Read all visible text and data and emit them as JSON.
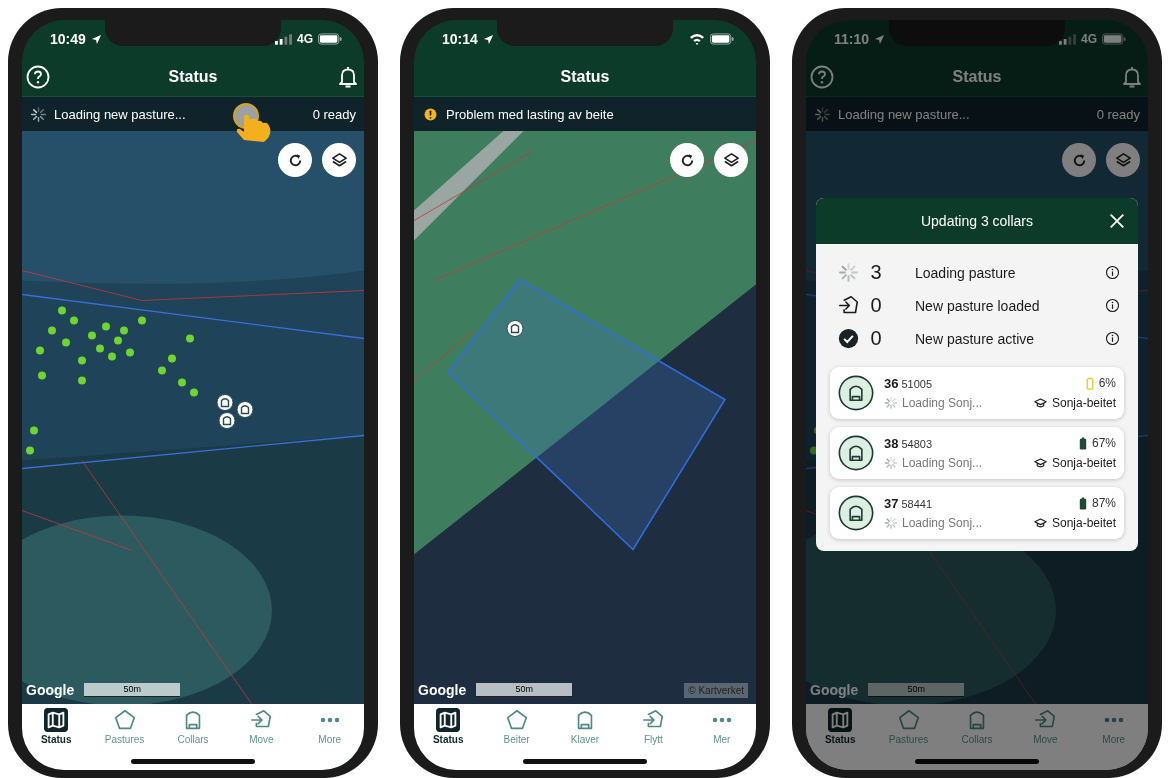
{
  "phones": [
    {
      "status_bar": {
        "time": "10:49",
        "connection": {
          "kind": "cellular",
          "label": "4G"
        }
      },
      "header": {
        "title": "Status",
        "help": true,
        "bell": true
      },
      "notice": {
        "kind": "loading",
        "text": "Loading new pasture...",
        "ready": "0 ready"
      },
      "tap_hint": true,
      "dimmed": false,
      "map": {
        "kind": "forest",
        "attribution": "Google",
        "scale": "50m"
      },
      "tabs": [
        {
          "kind": "map",
          "label": "Status",
          "selected": true
        },
        {
          "kind": "pasture",
          "label": "Pastures",
          "selected": false
        },
        {
          "kind": "collar",
          "label": "Collars",
          "selected": false
        },
        {
          "kind": "move",
          "label": "Move",
          "selected": false
        },
        {
          "kind": "more",
          "label": "More",
          "selected": false
        }
      ]
    },
    {
      "status_bar": {
        "time": "10:14",
        "connection": {
          "kind": "wifi"
        }
      },
      "header": {
        "title": "Status",
        "help": false,
        "bell": false
      },
      "notice": {
        "kind": "warning",
        "text": "Problem med lasting av beite"
      },
      "tap_hint": false,
      "dimmed": false,
      "map": {
        "kind": "field",
        "attribution": "Google",
        "scale": "50m",
        "credit": "© Kartverket"
      },
      "tabs": [
        {
          "kind": "map",
          "label": "Status",
          "selected": true
        },
        {
          "kind": "pasture",
          "label": "Beiter",
          "selected": false
        },
        {
          "kind": "collar",
          "label": "Klaver",
          "selected": false
        },
        {
          "kind": "move",
          "label": "Flytt",
          "selected": false
        },
        {
          "kind": "more",
          "label": "Mer",
          "selected": false
        }
      ]
    },
    {
      "status_bar": {
        "time": "11:10",
        "connection": {
          "kind": "cellular",
          "label": "4G"
        }
      },
      "header": {
        "title": "Status",
        "help": true,
        "bell": true
      },
      "notice": {
        "kind": "loading",
        "text": "Loading new pasture...",
        "ready": "0 ready"
      },
      "tap_hint": false,
      "dimmed": true,
      "map": {
        "kind": "forest",
        "attribution": "Google",
        "scale": "50m"
      },
      "tabs": [
        {
          "kind": "map",
          "label": "Status",
          "selected": true
        },
        {
          "kind": "pasture",
          "label": "Pastures",
          "selected": false
        },
        {
          "kind": "collar",
          "label": "Collars",
          "selected": false
        },
        {
          "kind": "move",
          "label": "Move",
          "selected": false
        },
        {
          "kind": "more",
          "label": "More",
          "selected": false
        }
      ],
      "dialog": {
        "title": "Updating 3 collars",
        "summary": [
          {
            "kind": "loading",
            "count": "3",
            "label": "Loading pasture"
          },
          {
            "kind": "loaded",
            "count": "0",
            "label": "New pasture loaded"
          },
          {
            "kind": "active",
            "count": "0",
            "label": "New pasture active"
          }
        ],
        "collars": [
          {
            "number": "36",
            "serial": "51005",
            "battery": "6%",
            "battery_low": true,
            "status": "Loading Sonj...",
            "pasture": "Sonja-beitet"
          },
          {
            "number": "38",
            "serial": "54803",
            "battery": "67%",
            "battery_low": false,
            "status": "Loading Sonj...",
            "pasture": "Sonja-beitet"
          },
          {
            "number": "37",
            "serial": "58441",
            "battery": "87%",
            "battery_low": false,
            "status": "Loading Sonj...",
            "pasture": "Sonja-beitet"
          }
        ]
      }
    }
  ]
}
